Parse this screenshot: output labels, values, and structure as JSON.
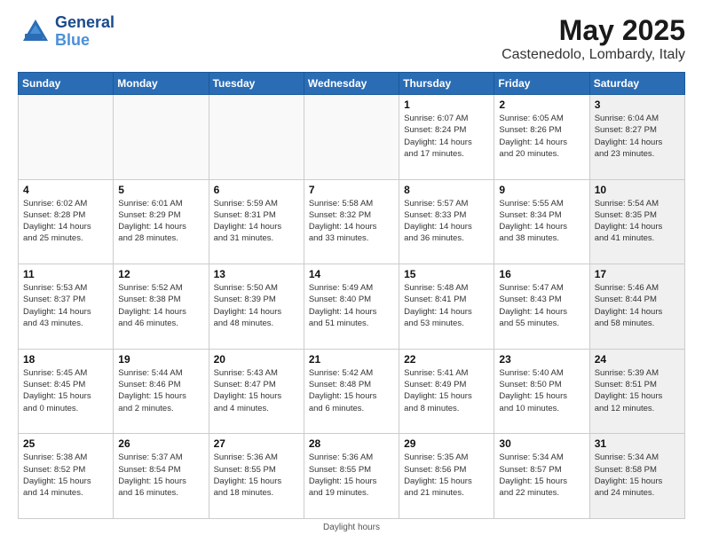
{
  "header": {
    "logo_line1": "General",
    "logo_line2": "Blue",
    "month": "May 2025",
    "location": "Castenedolo, Lombardy, Italy"
  },
  "days_of_week": [
    "Sunday",
    "Monday",
    "Tuesday",
    "Wednesday",
    "Thursday",
    "Friday",
    "Saturday"
  ],
  "footer": "Daylight hours",
  "weeks": [
    [
      {
        "day": "",
        "info": "",
        "empty": true
      },
      {
        "day": "",
        "info": "",
        "empty": true
      },
      {
        "day": "",
        "info": "",
        "empty": true
      },
      {
        "day": "",
        "info": "",
        "empty": true
      },
      {
        "day": "1",
        "info": "Sunrise: 6:07 AM\nSunset: 8:24 PM\nDaylight: 14 hours\nand 17 minutes.",
        "empty": false
      },
      {
        "day": "2",
        "info": "Sunrise: 6:05 AM\nSunset: 8:26 PM\nDaylight: 14 hours\nand 20 minutes.",
        "empty": false
      },
      {
        "day": "3",
        "info": "Sunrise: 6:04 AM\nSunset: 8:27 PM\nDaylight: 14 hours\nand 23 minutes.",
        "empty": false,
        "shaded": true
      }
    ],
    [
      {
        "day": "4",
        "info": "Sunrise: 6:02 AM\nSunset: 8:28 PM\nDaylight: 14 hours\nand 25 minutes.",
        "empty": false
      },
      {
        "day": "5",
        "info": "Sunrise: 6:01 AM\nSunset: 8:29 PM\nDaylight: 14 hours\nand 28 minutes.",
        "empty": false
      },
      {
        "day": "6",
        "info": "Sunrise: 5:59 AM\nSunset: 8:31 PM\nDaylight: 14 hours\nand 31 minutes.",
        "empty": false
      },
      {
        "day": "7",
        "info": "Sunrise: 5:58 AM\nSunset: 8:32 PM\nDaylight: 14 hours\nand 33 minutes.",
        "empty": false
      },
      {
        "day": "8",
        "info": "Sunrise: 5:57 AM\nSunset: 8:33 PM\nDaylight: 14 hours\nand 36 minutes.",
        "empty": false
      },
      {
        "day": "9",
        "info": "Sunrise: 5:55 AM\nSunset: 8:34 PM\nDaylight: 14 hours\nand 38 minutes.",
        "empty": false
      },
      {
        "day": "10",
        "info": "Sunrise: 5:54 AM\nSunset: 8:35 PM\nDaylight: 14 hours\nand 41 minutes.",
        "empty": false,
        "shaded": true
      }
    ],
    [
      {
        "day": "11",
        "info": "Sunrise: 5:53 AM\nSunset: 8:37 PM\nDaylight: 14 hours\nand 43 minutes.",
        "empty": false
      },
      {
        "day": "12",
        "info": "Sunrise: 5:52 AM\nSunset: 8:38 PM\nDaylight: 14 hours\nand 46 minutes.",
        "empty": false
      },
      {
        "day": "13",
        "info": "Sunrise: 5:50 AM\nSunset: 8:39 PM\nDaylight: 14 hours\nand 48 minutes.",
        "empty": false
      },
      {
        "day": "14",
        "info": "Sunrise: 5:49 AM\nSunset: 8:40 PM\nDaylight: 14 hours\nand 51 minutes.",
        "empty": false
      },
      {
        "day": "15",
        "info": "Sunrise: 5:48 AM\nSunset: 8:41 PM\nDaylight: 14 hours\nand 53 minutes.",
        "empty": false
      },
      {
        "day": "16",
        "info": "Sunrise: 5:47 AM\nSunset: 8:43 PM\nDaylight: 14 hours\nand 55 minutes.",
        "empty": false
      },
      {
        "day": "17",
        "info": "Sunrise: 5:46 AM\nSunset: 8:44 PM\nDaylight: 14 hours\nand 58 minutes.",
        "empty": false,
        "shaded": true
      }
    ],
    [
      {
        "day": "18",
        "info": "Sunrise: 5:45 AM\nSunset: 8:45 PM\nDaylight: 15 hours\nand 0 minutes.",
        "empty": false
      },
      {
        "day": "19",
        "info": "Sunrise: 5:44 AM\nSunset: 8:46 PM\nDaylight: 15 hours\nand 2 minutes.",
        "empty": false
      },
      {
        "day": "20",
        "info": "Sunrise: 5:43 AM\nSunset: 8:47 PM\nDaylight: 15 hours\nand 4 minutes.",
        "empty": false
      },
      {
        "day": "21",
        "info": "Sunrise: 5:42 AM\nSunset: 8:48 PM\nDaylight: 15 hours\nand 6 minutes.",
        "empty": false
      },
      {
        "day": "22",
        "info": "Sunrise: 5:41 AM\nSunset: 8:49 PM\nDaylight: 15 hours\nand 8 minutes.",
        "empty": false
      },
      {
        "day": "23",
        "info": "Sunrise: 5:40 AM\nSunset: 8:50 PM\nDaylight: 15 hours\nand 10 minutes.",
        "empty": false
      },
      {
        "day": "24",
        "info": "Sunrise: 5:39 AM\nSunset: 8:51 PM\nDaylight: 15 hours\nand 12 minutes.",
        "empty": false,
        "shaded": true
      }
    ],
    [
      {
        "day": "25",
        "info": "Sunrise: 5:38 AM\nSunset: 8:52 PM\nDaylight: 15 hours\nand 14 minutes.",
        "empty": false
      },
      {
        "day": "26",
        "info": "Sunrise: 5:37 AM\nSunset: 8:54 PM\nDaylight: 15 hours\nand 16 minutes.",
        "empty": false
      },
      {
        "day": "27",
        "info": "Sunrise: 5:36 AM\nSunset: 8:55 PM\nDaylight: 15 hours\nand 18 minutes.",
        "empty": false
      },
      {
        "day": "28",
        "info": "Sunrise: 5:36 AM\nSunset: 8:55 PM\nDaylight: 15 hours\nand 19 minutes.",
        "empty": false
      },
      {
        "day": "29",
        "info": "Sunrise: 5:35 AM\nSunset: 8:56 PM\nDaylight: 15 hours\nand 21 minutes.",
        "empty": false
      },
      {
        "day": "30",
        "info": "Sunrise: 5:34 AM\nSunset: 8:57 PM\nDaylight: 15 hours\nand 22 minutes.",
        "empty": false
      },
      {
        "day": "31",
        "info": "Sunrise: 5:34 AM\nSunset: 8:58 PM\nDaylight: 15 hours\nand 24 minutes.",
        "empty": false,
        "shaded": true
      }
    ]
  ]
}
